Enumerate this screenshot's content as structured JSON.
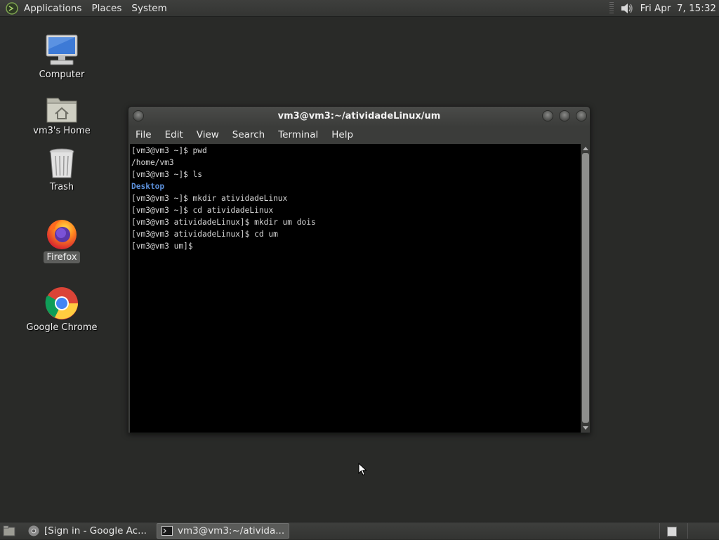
{
  "top_panel": {
    "menus": [
      "Applications",
      "Places",
      "System"
    ],
    "clock": "Fri Apr  7, 15:32"
  },
  "desktop_icons": [
    {
      "label": "Computer",
      "icon": "computer-icon"
    },
    {
      "label": "vm3's Home",
      "icon": "home-folder-icon"
    },
    {
      "label": "Trash",
      "icon": "trash-icon"
    },
    {
      "label": "Firefox",
      "icon": "firefox-icon",
      "selected": true
    },
    {
      "label": "Google Chrome",
      "icon": "chrome-icon"
    }
  ],
  "terminal": {
    "title": "vm3@vm3:~/atividadeLinux/um",
    "menus": [
      "File",
      "Edit",
      "View",
      "Search",
      "Terminal",
      "Help"
    ],
    "lines": [
      {
        "text": "[vm3@vm3 ~]$ pwd",
        "type": "prompt"
      },
      {
        "text": "/home/vm3",
        "type": "output"
      },
      {
        "text": "[vm3@vm3 ~]$ ls",
        "type": "prompt"
      },
      {
        "text": "Desktop",
        "type": "dir"
      },
      {
        "text": "[vm3@vm3 ~]$ mkdir atividadeLinux",
        "type": "prompt"
      },
      {
        "text": "[vm3@vm3 ~]$ cd atividadeLinux",
        "type": "prompt"
      },
      {
        "text": "[vm3@vm3 atividadeLinux]$ mkdir um dois",
        "type": "prompt"
      },
      {
        "text": "[vm3@vm3 atividadeLinux]$ cd um",
        "type": "prompt"
      },
      {
        "text": "[vm3@vm3 um]$ ",
        "type": "prompt"
      }
    ]
  },
  "taskbar": {
    "tasks": [
      {
        "label": "[Sign in - Google Ac...",
        "icon": "chrome-icon",
        "active": false
      },
      {
        "label": "vm3@vm3:~/ativida...",
        "icon": "terminal-icon",
        "active": true
      }
    ]
  },
  "colors": {
    "desktop_bg": "#292a28",
    "panel_bg": "#3a3b39",
    "terminal_bg": "#000000",
    "terminal_fg": "#d6d6d6",
    "directory_color": "#5b8fd9"
  }
}
